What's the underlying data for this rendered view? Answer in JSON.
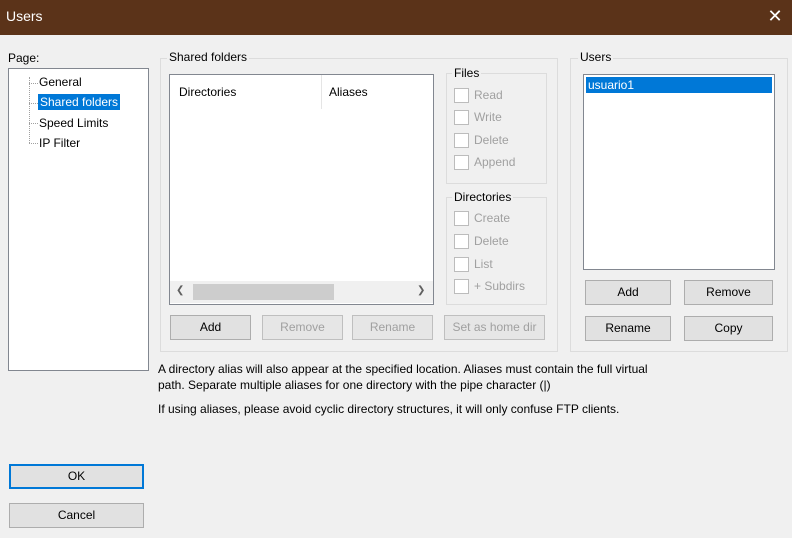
{
  "window": {
    "title": "Users",
    "close_glyph": "✕"
  },
  "page_tree": {
    "label": "Page:",
    "items": [
      {
        "label": "General",
        "selected": false
      },
      {
        "label": "Shared folders",
        "selected": true
      },
      {
        "label": "Speed Limits",
        "selected": false
      },
      {
        "label": "IP Filter",
        "selected": false
      }
    ]
  },
  "shared_folders": {
    "group_label": "Shared folders",
    "columns": [
      "Directories",
      "Aliases"
    ],
    "buttons": {
      "add": "Add",
      "remove": "Remove",
      "rename": "Rename",
      "set_home": "Set as home dir"
    },
    "files": {
      "label": "Files",
      "options": [
        "Read",
        "Write",
        "Delete",
        "Append"
      ]
    },
    "directories": {
      "label": "Directories",
      "options": [
        "Create",
        "Delete",
        "List",
        "+ Subdirs"
      ]
    },
    "scroll_left": "❮",
    "scroll_right": "❯"
  },
  "users": {
    "group_label": "Users",
    "list": [
      "usuario1"
    ],
    "buttons": {
      "add": "Add",
      "remove": "Remove",
      "rename": "Rename",
      "copy": "Copy"
    }
  },
  "info": {
    "line1": "A directory alias will also appear at the specified location. Aliases must contain the full virtual",
    "line2": "path. Separate multiple aliases for one directory with the pipe character (|)",
    "line3": "If using aliases, please avoid cyclic directory structures, it will only confuse FTP clients."
  },
  "dialog_buttons": {
    "ok": "OK",
    "cancel": "Cancel"
  },
  "colors": {
    "titlebar": "#5b3319",
    "selection": "#0078d7",
    "default_button_border": "#0078d7"
  }
}
